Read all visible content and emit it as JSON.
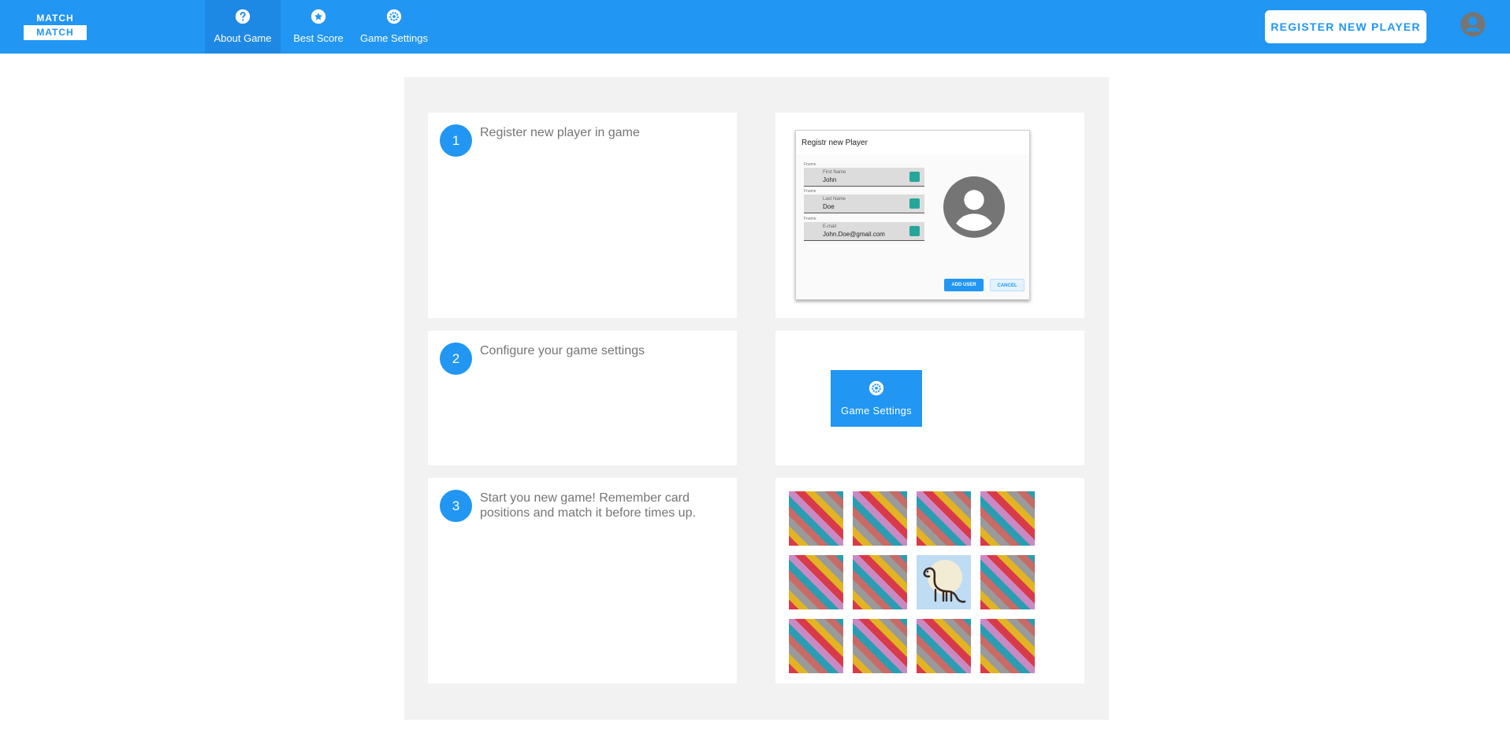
{
  "app": {
    "logo_top": "MATCH",
    "logo_bottom": "MATCH"
  },
  "nav": {
    "items": [
      {
        "label": "About Game",
        "icon": "question-circle-icon",
        "active": true
      },
      {
        "label": "Best Score",
        "icon": "star-circle-icon",
        "active": false
      },
      {
        "label": "Game Settings",
        "icon": "gear-icon",
        "active": false
      }
    ]
  },
  "header": {
    "register_label": "REGISTER NEW PLAYER",
    "avatar_icon": "account-circle-icon"
  },
  "steps": [
    {
      "number": "1",
      "text": "Register new player in game"
    },
    {
      "number": "2",
      "text": "Configure your game settings"
    },
    {
      "number": "3",
      "text": "Start you new game! Remember card positions and match it before times up."
    }
  ],
  "register_preview": {
    "title": "Registr new Player",
    "fields": [
      {
        "caption": "Fname",
        "label": "First Name",
        "value": "John"
      },
      {
        "caption": "Fname",
        "label": "Last Name",
        "value": "Doe"
      },
      {
        "caption": "Fname",
        "label": "E-mail",
        "value": "John.Doe@gmail.com"
      }
    ],
    "add_label": "ADD USER",
    "cancel_label": "CANCEL"
  },
  "settings_preview": {
    "label": "Game Settings",
    "icon": "gear-icon"
  },
  "memory_grid": {
    "rows": 3,
    "cols": 4,
    "revealed_index": 6,
    "revealed_icon": "dinosaur-icon"
  },
  "colors": {
    "primary": "#2196f3",
    "panel_bg": "#f2f2f2",
    "text_muted": "#757575"
  }
}
